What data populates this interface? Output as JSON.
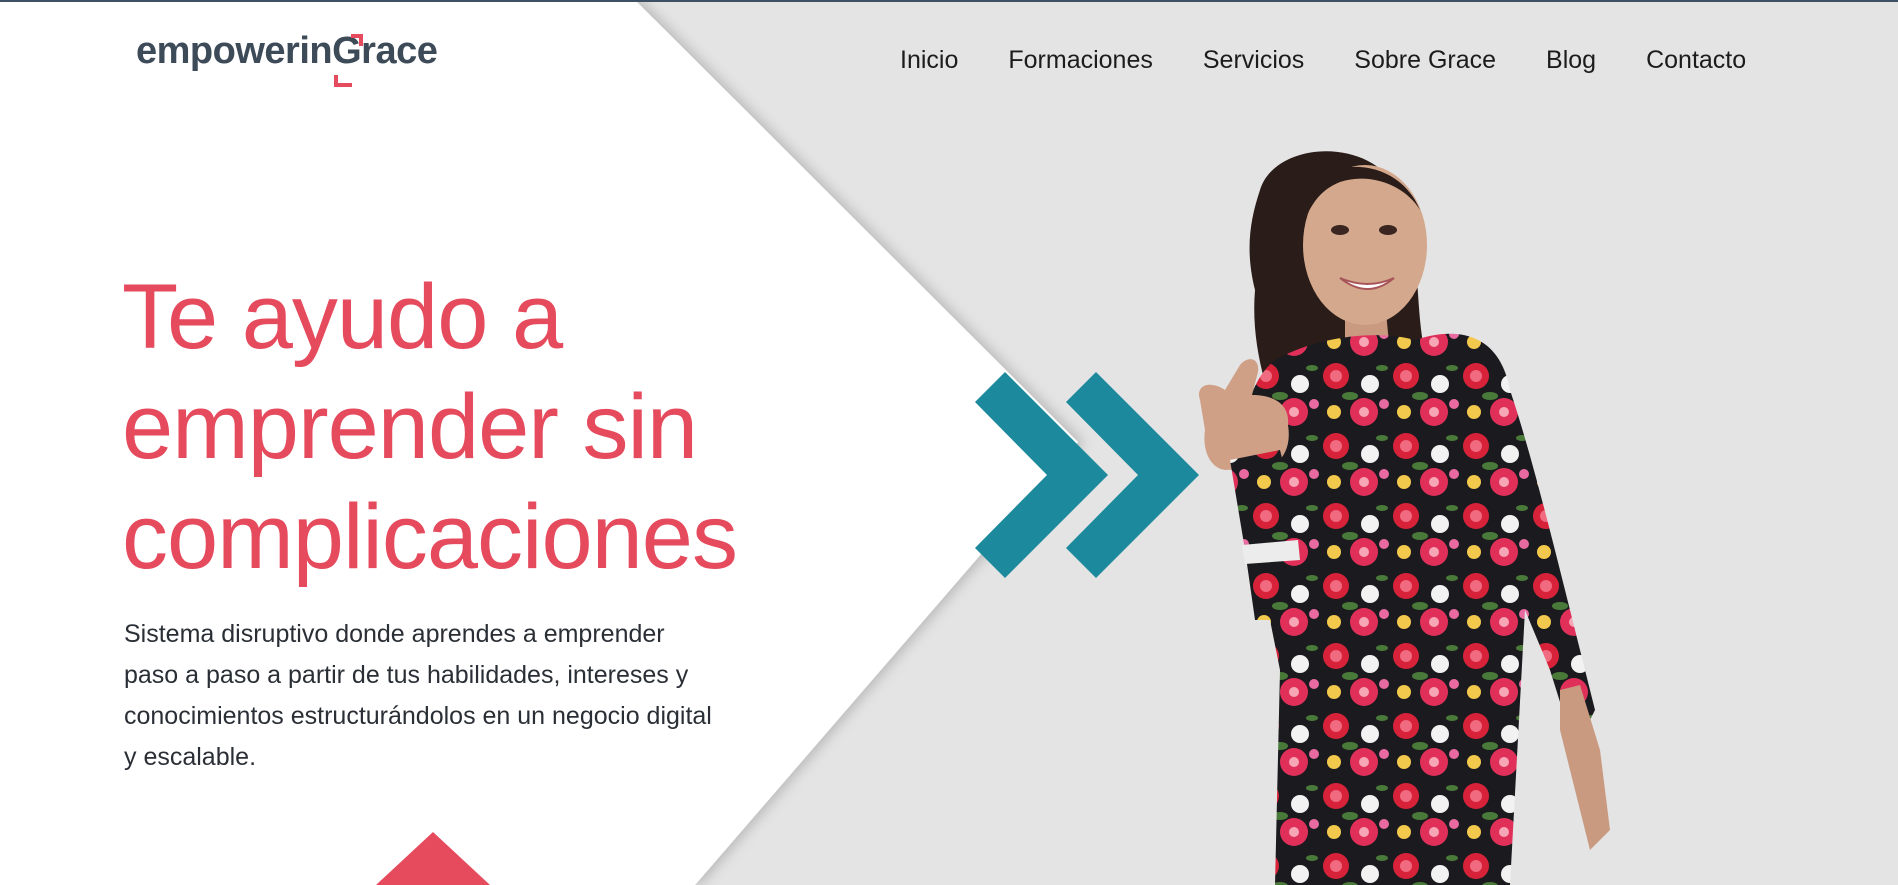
{
  "logo": {
    "text_before": "empowerin",
    "text_g": "G",
    "text_after": "race"
  },
  "nav": {
    "items": [
      "Inicio",
      "Formaciones",
      "Servicios",
      "Sobre Grace",
      "Blog",
      "Contacto"
    ]
  },
  "hero": {
    "title_lines": [
      "Te ayudo a",
      "emprender sin",
      "complicaciones"
    ],
    "subtitle_lines": [
      "Sistema disruptivo donde aprendes a emprender",
      "paso a paso a partir de tus habilidades, intereses y",
      "conocimientos estructurándolos en un negocio digital",
      "y escalable."
    ]
  },
  "icons": {
    "chevrons": "double-chevron-right-icon",
    "bottom": "arrow-up-shape"
  },
  "colors": {
    "accent": "#e54a5d",
    "teal": "#1c8a9c",
    "dark": "#3d4a57",
    "bg_gray": "#e4e4e4"
  }
}
